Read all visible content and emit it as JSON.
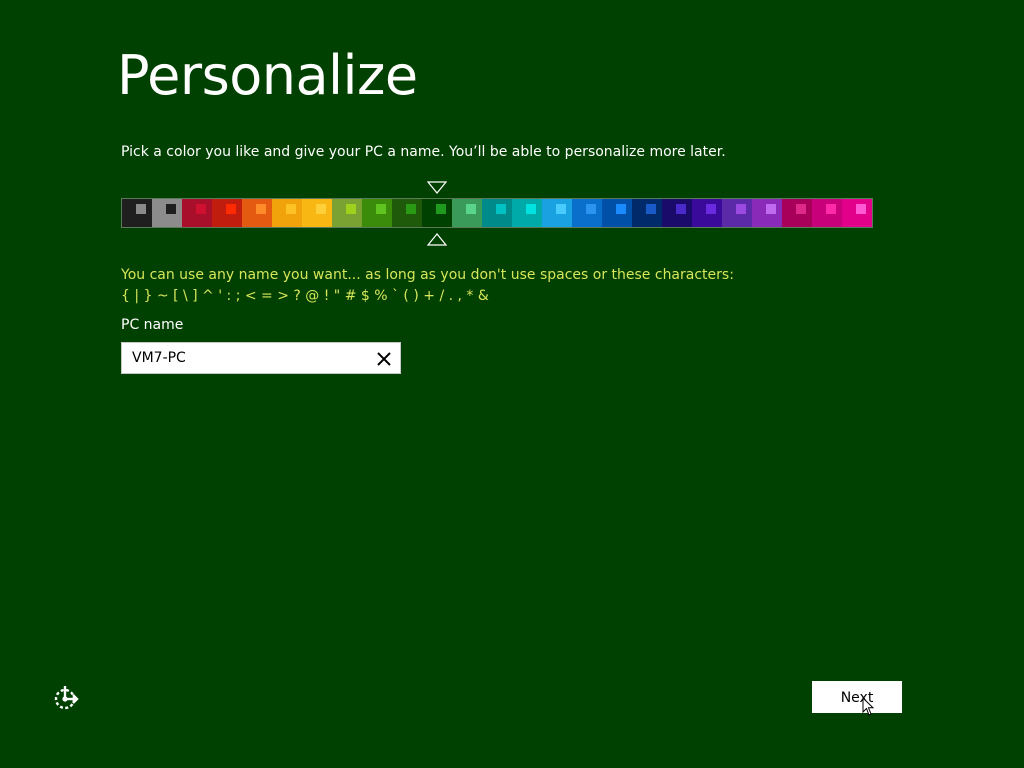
{
  "header": {
    "title": "Personalize",
    "subtitle": "Pick a color you like and give your PC a name. You’ll be able to personalize more later."
  },
  "colors": {
    "background": "#004000",
    "warning_text": "#d8e65a",
    "selected_index": 10,
    "swatches": [
      {
        "bg": "#1f1f1f",
        "accent": "#8a8a8a"
      },
      {
        "bg": "#8c8c8c",
        "accent": "#1f1f1f"
      },
      {
        "bg": "#a80f2a",
        "accent": "#d01030"
      },
      {
        "bg": "#c11d0e",
        "accent": "#ff2a00"
      },
      {
        "bg": "#e45a10",
        "accent": "#ff8a2a"
      },
      {
        "bg": "#f0a30a",
        "accent": "#ffc226"
      },
      {
        "bg": "#f8b712",
        "accent": "#ffd03a"
      },
      {
        "bg": "#7aa233",
        "accent": "#9ed11c"
      },
      {
        "bg": "#3a8c0a",
        "accent": "#5fc41f"
      },
      {
        "bg": "#1e5a0a",
        "accent": "#2a9a14"
      },
      {
        "bg": "#004000",
        "accent": "#1e9a1e"
      },
      {
        "bg": "#3a9a5a",
        "accent": "#5ad48a"
      },
      {
        "bg": "#008a8a",
        "accent": "#00c2c2"
      },
      {
        "bg": "#00aaa8",
        "accent": "#00e2e0"
      },
      {
        "bg": "#1aa1e2",
        "accent": "#4acbff"
      },
      {
        "bg": "#0a6ecb",
        "accent": "#2a94f0"
      },
      {
        "bg": "#0050a8",
        "accent": "#1a8aff"
      },
      {
        "bg": "#002a6a",
        "accent": "#1a5ac8"
      },
      {
        "bg": "#1a0a6a",
        "accent": "#4a2acb"
      },
      {
        "bg": "#3a0a9a",
        "accent": "#6a2ae0"
      },
      {
        "bg": "#5a2aa8",
        "accent": "#9a4ae0"
      },
      {
        "bg": "#8a2ab8",
        "accent": "#c06af0"
      },
      {
        "bg": "#a8005a",
        "accent": "#e02a8a"
      },
      {
        "bg": "#c8007a",
        "accent": "#ff2aa8"
      },
      {
        "bg": "#e2008a",
        "accent": "#ff5ad4"
      }
    ]
  },
  "rules": {
    "line1": "You can use any name you want... as long as you don't use spaces or these characters:",
    "line2": "{ | } ~ [ \\ ] ^ ' : ; < = > ? @ ! \" # $ % ` ( ) + / . , * &"
  },
  "pc_name": {
    "label": "PC name",
    "value": "VM7-PC"
  },
  "footer": {
    "next_label": "Next",
    "ease_icon": "ease-of-access-icon"
  }
}
